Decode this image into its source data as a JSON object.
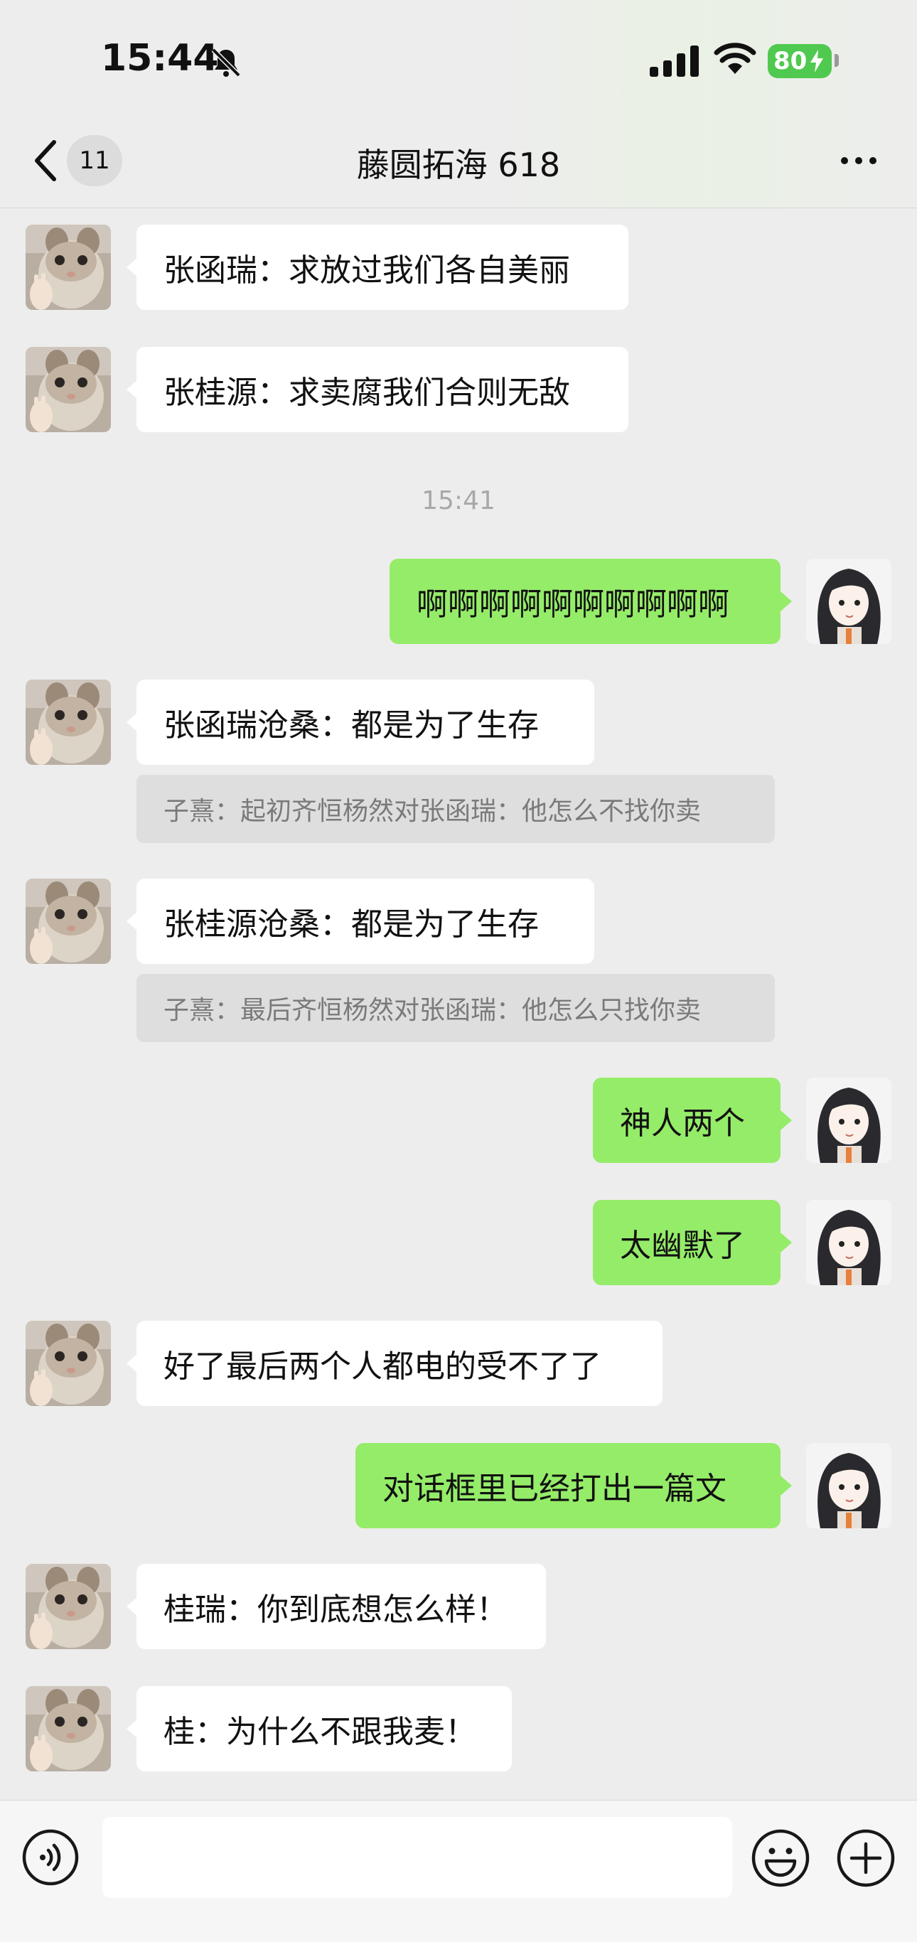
{
  "status_bar": {
    "time": "15:44",
    "battery": "80"
  },
  "header": {
    "unread_count": "11",
    "title": "藤圆拓海 618"
  },
  "timestamp": "15:41",
  "messages": [
    {
      "side": "in",
      "text": "张函瑞：求放过我们各自美丽"
    },
    {
      "side": "in",
      "text": "张桂源：求卖腐我们合则无敌"
    },
    {
      "side": "out",
      "text": "啊啊啊啊啊啊啊啊啊啊"
    },
    {
      "side": "in",
      "text": "张函瑞沧桑：都是为了生存",
      "quote": "子熹：起初齐恒杨然对张函瑞：他怎么不找你卖"
    },
    {
      "side": "in",
      "text": "张桂源沧桑：都是为了生存",
      "quote": "子熹：最后齐恒杨然对张函瑞：他怎么只找你卖"
    },
    {
      "side": "out",
      "text": "神人两个"
    },
    {
      "side": "out",
      "text": "太幽默了"
    },
    {
      "side": "in",
      "text": "好了最后两个人都电的受不了了"
    },
    {
      "side": "out",
      "text": "对话框里已经打出一篇文"
    },
    {
      "side": "in",
      "text": "桂瑞：你到底想怎么样！"
    },
    {
      "side": "in",
      "text": "桂：为什么不跟我麦！"
    }
  ],
  "input": {
    "value": ""
  },
  "colors": {
    "sent_bubble": "#95ec69",
    "received_bubble": "#ffffff",
    "background": "#ededed"
  },
  "icons": [
    "bell-muted-icon",
    "signal-icon",
    "wifi-icon",
    "battery-icon",
    "back-arrow-icon",
    "more-icon",
    "voice-icon",
    "emoji-icon",
    "plus-icon"
  ]
}
